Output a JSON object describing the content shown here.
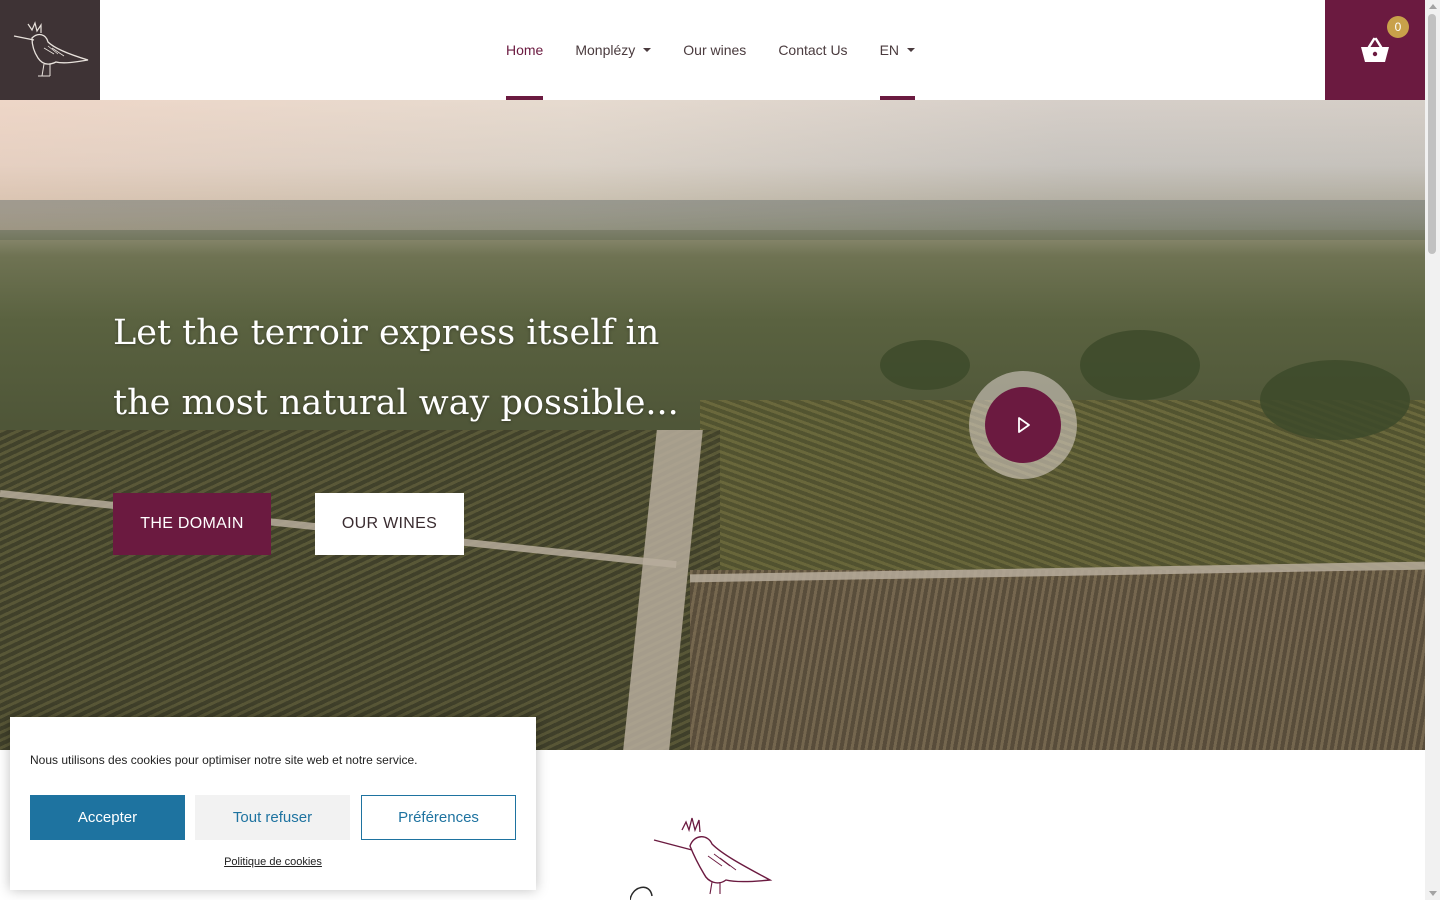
{
  "header": {
    "logo_icon": "hoopoe-bird-icon",
    "nav": [
      {
        "label": "Home",
        "active": true,
        "dropdown": false
      },
      {
        "label": "Monplézy",
        "active": false,
        "dropdown": true
      },
      {
        "label": "Our wines",
        "active": false,
        "dropdown": false
      },
      {
        "label": "Contact Us",
        "active": false,
        "dropdown": false
      },
      {
        "label": "EN",
        "active": true,
        "dropdown": true
      }
    ],
    "cart": {
      "icon": "basket-icon",
      "count": "0"
    }
  },
  "hero": {
    "headline": "Let the terroir express itself in the most natural way possible...",
    "buttons": {
      "domain": "THE DOMAIN",
      "wines": "OUR WINES"
    },
    "play_icon": "play-icon"
  },
  "cookie_banner": {
    "message": "Nous utilisons des cookies pour optimiser notre site web et notre service.",
    "accept": "Accepter",
    "refuse": "Tout refuser",
    "preferences": "Préférences",
    "policy_link": "Politique de cookies"
  },
  "colors": {
    "brand": "#6b1a40",
    "logo_bg": "#3e3335",
    "badge": "#c8a14a",
    "cookie_accent": "#1e73a0"
  }
}
